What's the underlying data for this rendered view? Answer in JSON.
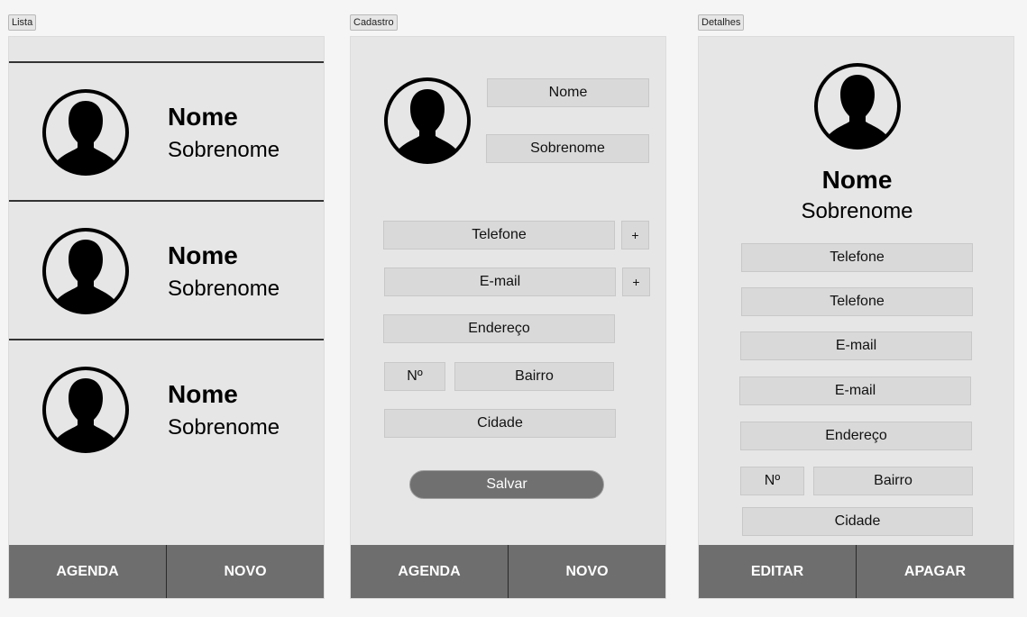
{
  "frames": {
    "lista": {
      "label": "Lista",
      "items": [
        {
          "name": "Nome",
          "surname": "Sobrenome"
        },
        {
          "name": "Nome",
          "surname": "Sobrenome"
        },
        {
          "name": "Nome",
          "surname": "Sobrenome"
        }
      ],
      "bottom": {
        "left": "AGENDA",
        "right": "NOVO"
      }
    },
    "cadastro": {
      "label": "Cadastro",
      "fields": {
        "name": "Nome",
        "surname": "Sobrenome",
        "phone": "Telefone",
        "phone_add": "+",
        "email": "E-mail",
        "email_add": "+",
        "address": "Endereço",
        "number": "Nº",
        "district": "Bairro",
        "city": "Cidade"
      },
      "save": "Salvar",
      "bottom": {
        "left": "AGENDA",
        "right": "NOVO"
      }
    },
    "detalhes": {
      "label": "Detalhes",
      "name": "Nome",
      "surname": "Sobrenome",
      "fields": {
        "phone1": "Telefone",
        "phone2": "Telefone",
        "email1": "E-mail",
        "email2": "E-mail",
        "address": "Endereço",
        "number": "Nº",
        "district": "Bairro",
        "city": "Cidade"
      },
      "bottom": {
        "left": "EDITAR",
        "right": "APAGAR"
      }
    }
  },
  "icons": {
    "avatar": "user-silhouette-icon"
  }
}
